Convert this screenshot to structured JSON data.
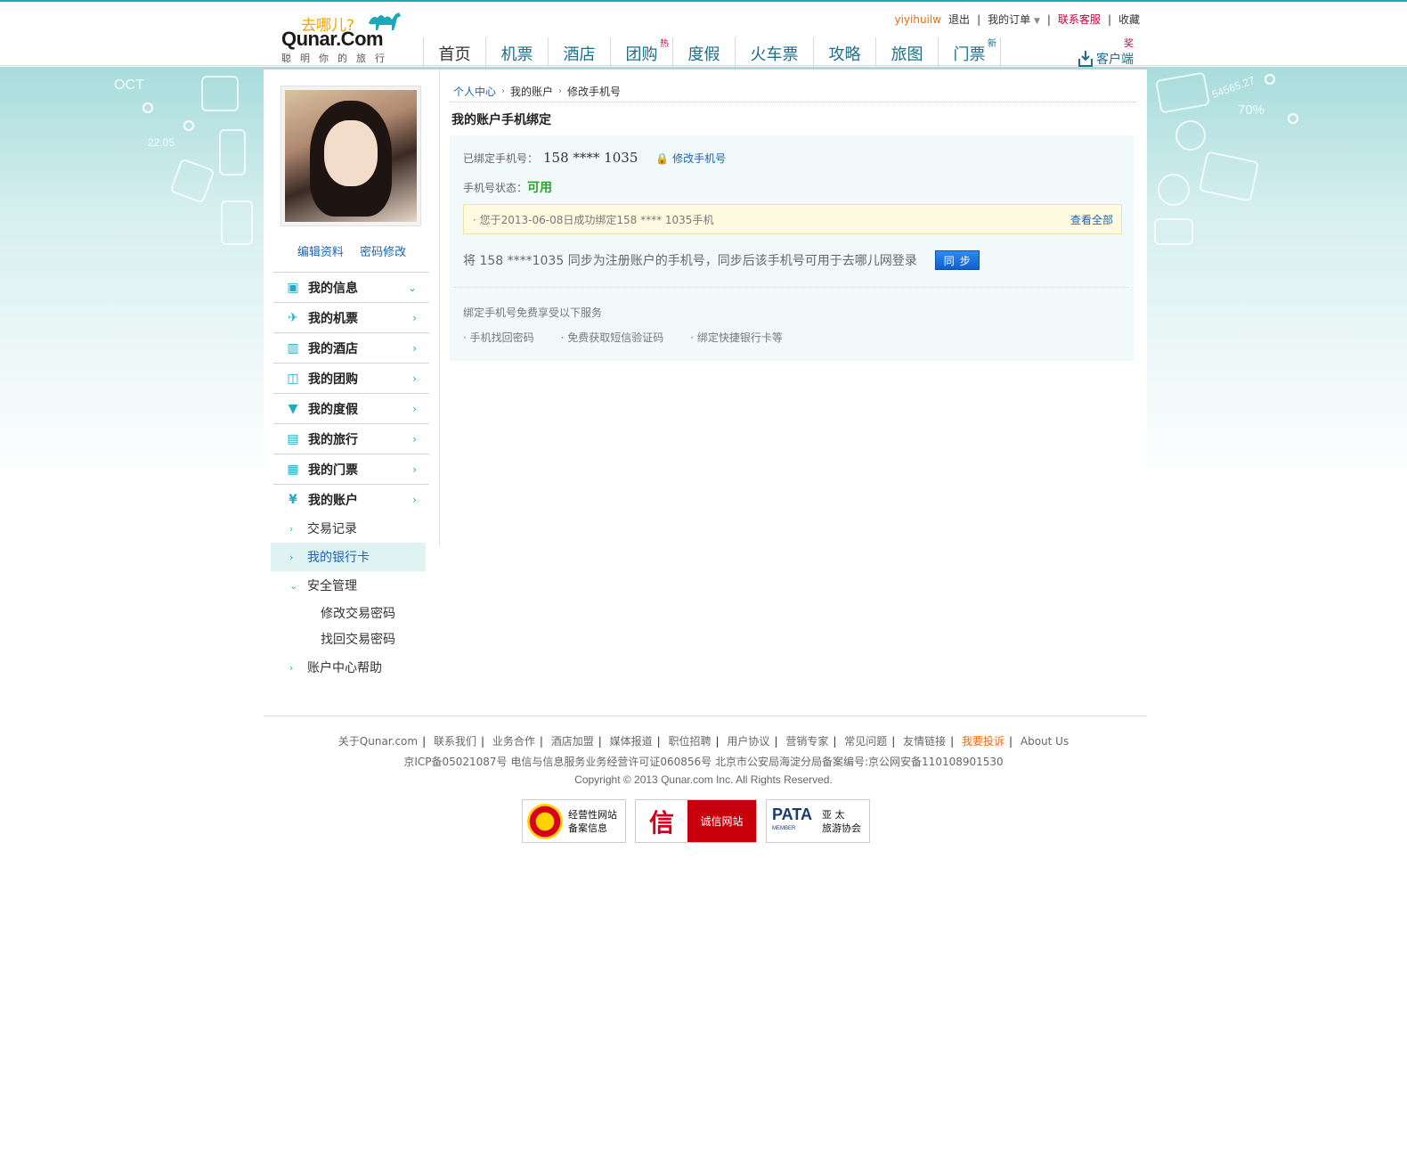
{
  "header": {
    "logo_cn": "去哪儿?",
    "logo_en": "Qunar.Com",
    "logo_slogan": "聪明你的旅行",
    "user": "yiyihuilw",
    "logout": "退出",
    "my_orders": "我的订单",
    "service": "联系客服",
    "favorite": "收藏",
    "sep": "|",
    "nav": [
      {
        "label": "首页"
      },
      {
        "label": "机票"
      },
      {
        "label": "酒店"
      },
      {
        "label": "团购",
        "tag": "热"
      },
      {
        "label": "度假"
      },
      {
        "label": "火车票"
      },
      {
        "label": "攻略"
      },
      {
        "label": "旅图"
      },
      {
        "label": "门票",
        "tag": "新"
      }
    ],
    "client_label": "客户端",
    "client_tag": "奖"
  },
  "background": {
    "deco_text": [
      "OCT",
      "22.05",
      "54565.27",
      "70%"
    ]
  },
  "sidebar": {
    "edit_profile": "编辑资料",
    "change_password": "密码修改",
    "menu": [
      {
        "label": "我的信息",
        "icon": "id-card-icon"
      },
      {
        "label": "我的机票",
        "icon": "airplane-icon"
      },
      {
        "label": "我的酒店",
        "icon": "building-icon"
      },
      {
        "label": "我的团购",
        "icon": "basket-icon"
      },
      {
        "label": "我的度假",
        "icon": "cocktail-icon"
      },
      {
        "label": "我的旅行",
        "icon": "suitcase-icon"
      },
      {
        "label": "我的门票",
        "icon": "ticket-icon"
      },
      {
        "label": "我的账户",
        "icon": "yuan-icon"
      }
    ],
    "submenu": [
      {
        "label": "交易记录"
      },
      {
        "label": "我的银行卡"
      },
      {
        "label": "安全管理"
      }
    ],
    "security_items": [
      "修改交易密码",
      "找回交易密码"
    ],
    "help": "账户中心帮助"
  },
  "main": {
    "breadcrumb": [
      "个人中心",
      "我的账户",
      "修改手机号"
    ],
    "title": "我的账户手机绑定",
    "bound_label": "已绑定手机号：",
    "bound_phone": "158 **** 1035",
    "change_phone": "修改手机号",
    "status_label": "手机号状态：",
    "status_value": "可用",
    "notice_text": "· 您于2013-06-08日成功绑定158 **** 1035手机",
    "view_all": "查看全部",
    "sync_text": "将 158 ****1035 同步为注册账户的手机号，同步后该手机号可用于去哪儿网登录",
    "sync_button": "同步",
    "benefit_title": "绑定手机号免费享受以下服务",
    "benefits": [
      "· 手机找回密码",
      "· 免费获取短信验证码",
      "· 绑定快捷银行卡等"
    ]
  },
  "footer": {
    "links": [
      "关于Qunar.com",
      "联系我们",
      "业务合作",
      "酒店加盟",
      "媒体报道",
      "职位招聘",
      "用户协议",
      "营销专家",
      "常见问题",
      "友情链接",
      "我要投诉",
      "About Us"
    ],
    "icp": "京ICP备05021087号   电信与信息服务业务经营许可证060856号   北京市公安局海淀分局备案编号:京公网安备110108901530",
    "copyright": "Copyright © 2013 Qunar.com Inc. All Rights Reserved.",
    "badge1": "经营性网站\n备案信息",
    "badge1_line1": "经营性网站",
    "badge1_line2": "备案信息",
    "badge2_left": "信",
    "badge2_right": "诚信网站",
    "badge3_logo": "PATA",
    "badge3_member": "MEMBER",
    "badge3_line1": "亚 太",
    "badge3_line2": "旅游协会"
  },
  "colors": {
    "accent": "#1ba9ba",
    "link": "#1a64b0",
    "ok": "#2aa52a",
    "warning_bg": "#fffbe1"
  }
}
